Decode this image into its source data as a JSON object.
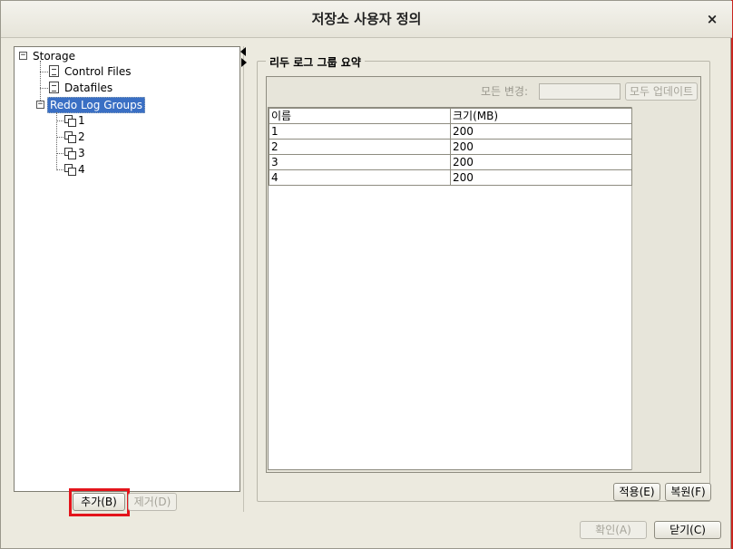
{
  "dialog": {
    "title": "저장소 사용자 정의",
    "close_icon": "×"
  },
  "tree": {
    "root": "Storage",
    "items": [
      {
        "label": "Control Files",
        "icon": "file-icon"
      },
      {
        "label": "Datafiles",
        "icon": "file-icon"
      },
      {
        "label": "Redo Log Groups",
        "icon": "folder",
        "selected": true,
        "children": [
          "1",
          "2",
          "3",
          "4"
        ]
      }
    ]
  },
  "left_buttons": {
    "add": "추가(B)",
    "remove": "제거(D)"
  },
  "summary": {
    "group_title": "리두 로그 그룹 요약",
    "bulk_label": "모든 변경:",
    "bulk_value": "",
    "update_all": "모두 업데이트",
    "columns": [
      "이름",
      "크기(MB)"
    ],
    "rows": [
      [
        "1",
        "200"
      ],
      [
        "2",
        "200"
      ],
      [
        "3",
        "200"
      ],
      [
        "4",
        "200"
      ]
    ]
  },
  "panel_buttons": {
    "apply": "적용(E)",
    "revert": "복원(F)"
  },
  "footer": {
    "ok": "확인(A)",
    "close": "닫기(C)"
  }
}
